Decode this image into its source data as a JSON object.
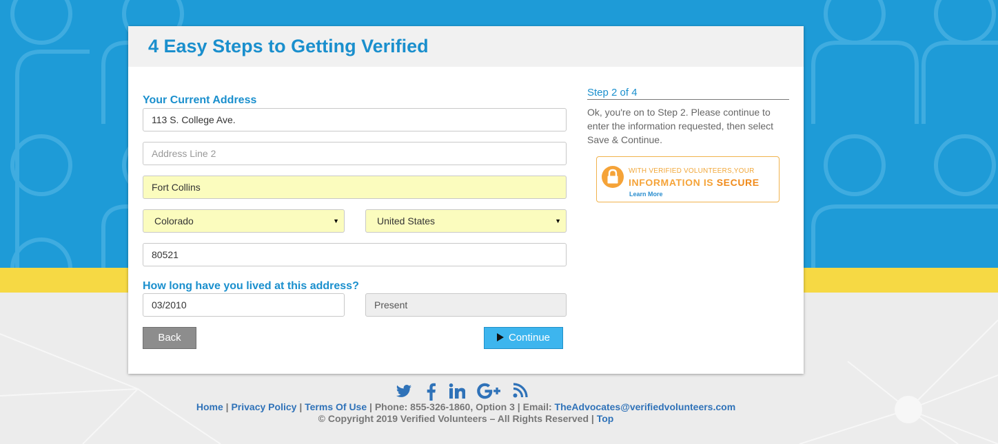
{
  "card": {
    "title": "4 Easy Steps to Getting Verified"
  },
  "address_section": {
    "label": "Your Current Address",
    "line1": "113 S. College Ave.",
    "line2_placeholder": "Address Line 2",
    "city": "Fort Collins",
    "state": "Colorado",
    "country": "United States",
    "zip": "80521"
  },
  "duration_section": {
    "label": "How long have you lived at this address?",
    "from": "03/2010",
    "to": "Present"
  },
  "buttons": {
    "back": "Back",
    "continue": "Continue"
  },
  "sidebar": {
    "step_title": "Step 2 of 4",
    "step_text": "Ok, you're on to Step 2. Please continue to enter the information requested, then select Save & Continue.",
    "badge": {
      "line1": "WITH VERIFIED VOLUNTEERS,YOUR",
      "line2a": "INFORMATION IS ",
      "line2b": "SECURE",
      "link": "Learn More"
    }
  },
  "socials": [
    "twitter-icon",
    "facebook-icon",
    "linkedin-icon",
    "google-plus-icon",
    "rss-icon"
  ],
  "footer": {
    "home": "Home",
    "sep": "|",
    "privacy": "Privacy Policy",
    "terms": "Terms Of Use",
    "phone": "Phone: 855-326-1860, Option 3",
    "email_label": "Email:",
    "email": "TheAdvocates@verifiedvolunteers.com",
    "copyright": "© Copyright 2019 Verified Volunteers – All Rights Reserved",
    "top": "Top"
  },
  "colors": {
    "brand_blue": "#1a8fcd",
    "background_blue": "#1e9bd7",
    "yellow_band": "#f6d944",
    "continue_button": "#3db5ee",
    "badge_orange": "#f5a338"
  }
}
